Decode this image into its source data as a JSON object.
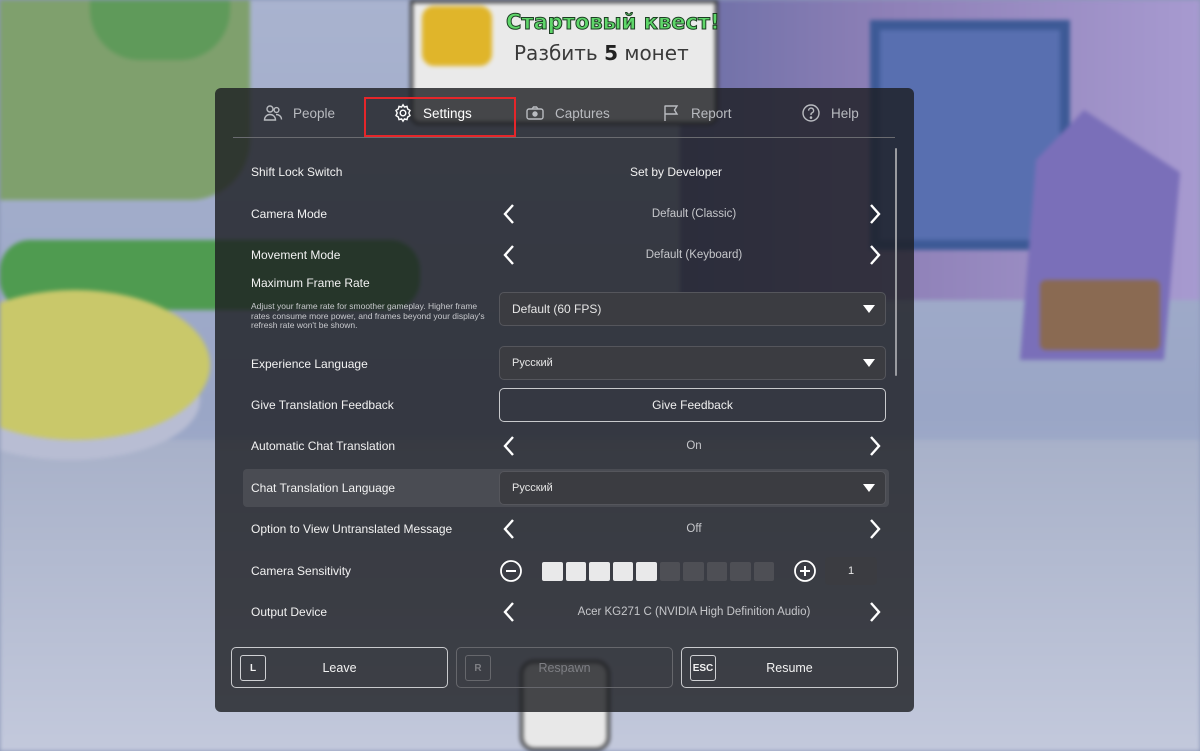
{
  "background": {
    "quest_title": "Стартовый квест!",
    "quest_sub_prefix": "Разбить ",
    "quest_sub_number": "5",
    "quest_sub_suffix": " монет"
  },
  "tabs": [
    {
      "label": "People",
      "icon": "people-icon",
      "active": false
    },
    {
      "label": "Settings",
      "icon": "gear-icon",
      "active": true
    },
    {
      "label": "Captures",
      "icon": "camera-icon",
      "active": false
    },
    {
      "label": "Report",
      "icon": "flag-icon",
      "active": false
    },
    {
      "label": "Help",
      "icon": "help-icon",
      "active": false
    }
  ],
  "settings": {
    "shift_lock": {
      "label": "Shift Lock Switch",
      "value": "Set by Developer"
    },
    "camera_mode": {
      "label": "Camera Mode",
      "value": "Default (Classic)"
    },
    "movement_mode": {
      "label": "Movement Mode",
      "value": "Default (Keyboard)"
    },
    "max_frame_rate": {
      "label": "Maximum Frame Rate",
      "description": "Adjust your frame rate for smoother gameplay. Higher frame rates consume more power, and frames beyond your display's refresh rate won't be shown.",
      "value": "Default (60 FPS)"
    },
    "experience_language": {
      "label": "Experience Language",
      "value": "Русский"
    },
    "translation_feedback": {
      "label": "Give Translation Feedback",
      "button": "Give Feedback"
    },
    "auto_chat_translation": {
      "label": "Automatic Chat Translation",
      "value": "On"
    },
    "chat_translation_language": {
      "label": "Chat Translation Language",
      "value": "Русский"
    },
    "view_untranslated": {
      "label": "Option to View Untranslated Message",
      "value": "Off"
    },
    "camera_sensitivity": {
      "label": "Camera Sensitivity",
      "value": "1",
      "segments_total": 10,
      "segments_on": 5
    },
    "output_device": {
      "label": "Output Device",
      "value": "Acer KG271 C (NVIDIA High Definition Audio)"
    }
  },
  "bottom_buttons": [
    {
      "key": "L",
      "label": "Leave",
      "enabled": true
    },
    {
      "key": "R",
      "label": "Respawn",
      "enabled": false
    },
    {
      "key": "ESC",
      "label": "Resume",
      "enabled": true
    }
  ],
  "colors": {
    "highlight_box": "#e5262a",
    "panel_bg": "#1c1d20",
    "sensitivity_on": "#e9e9ea",
    "sensitivity_off": "#4e4f55"
  }
}
